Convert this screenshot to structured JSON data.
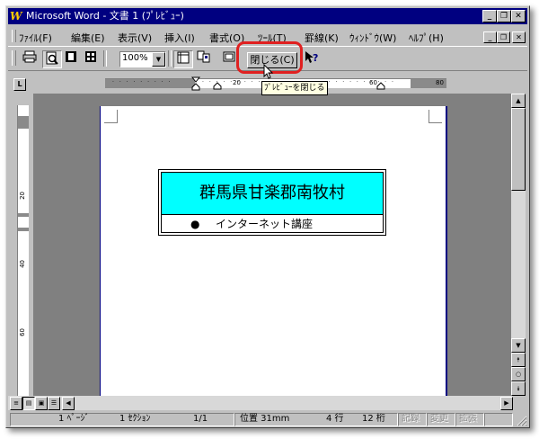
{
  "window": {
    "title": "Microsoft Word - 文書 1 (ﾌﾟﾚﾋﾞｭｰ)",
    "app_icon": "W"
  },
  "title_buttons": {
    "minimize": "_",
    "restore": "❐",
    "close": "✕"
  },
  "menu": {
    "items": [
      {
        "label": "ﾌｧｲﾙ(F)"
      },
      {
        "label": "編集(E)"
      },
      {
        "label": "表示(V)"
      },
      {
        "label": "挿入(I)"
      },
      {
        "label": "書式(O)"
      },
      {
        "label": "ﾂｰﾙ(T)"
      },
      {
        "label": "罫線(K)"
      },
      {
        "label": "ｳｨﾝﾄﾞｳ(W)"
      },
      {
        "label": "ﾍﾙﾌﾟ(H)"
      }
    ]
  },
  "toolbar": {
    "zoom_value": "100%",
    "close_button_label": "閉じる(C)",
    "tooltip": "ﾌﾟﾚﾋﾞｭｰを閉じる",
    "icons": [
      "print-icon",
      "magnifier-icon",
      "one-page-icon",
      "multiple-pages-icon",
      "view-ruler-icon",
      "shrink-to-fit-icon",
      "full-screen-icon",
      "context-help-icon"
    ]
  },
  "ruler": {
    "h_labels": [
      "20",
      "60",
      "80"
    ],
    "v_labels": [
      "20",
      "40",
      "60"
    ]
  },
  "document": {
    "table_header": "群馬県甘楽郡南牧村",
    "bullet": "●",
    "item": "インターネット講座"
  },
  "statusbar": {
    "page": "1 ﾍﾟｰｼﾞ",
    "section": "1 ｾｸｼｮﾝ",
    "page_of": "1/1",
    "position": "位置 31mm",
    "line": "4 行",
    "column": "12 桁",
    "rec": "記録",
    "trk": "変更",
    "ext": "拡張"
  },
  "colors": {
    "title_bar": "#000080",
    "highlight": "#e02020",
    "table_header_bg": "#00ffff",
    "tooltip_bg": "#ffffe1"
  }
}
